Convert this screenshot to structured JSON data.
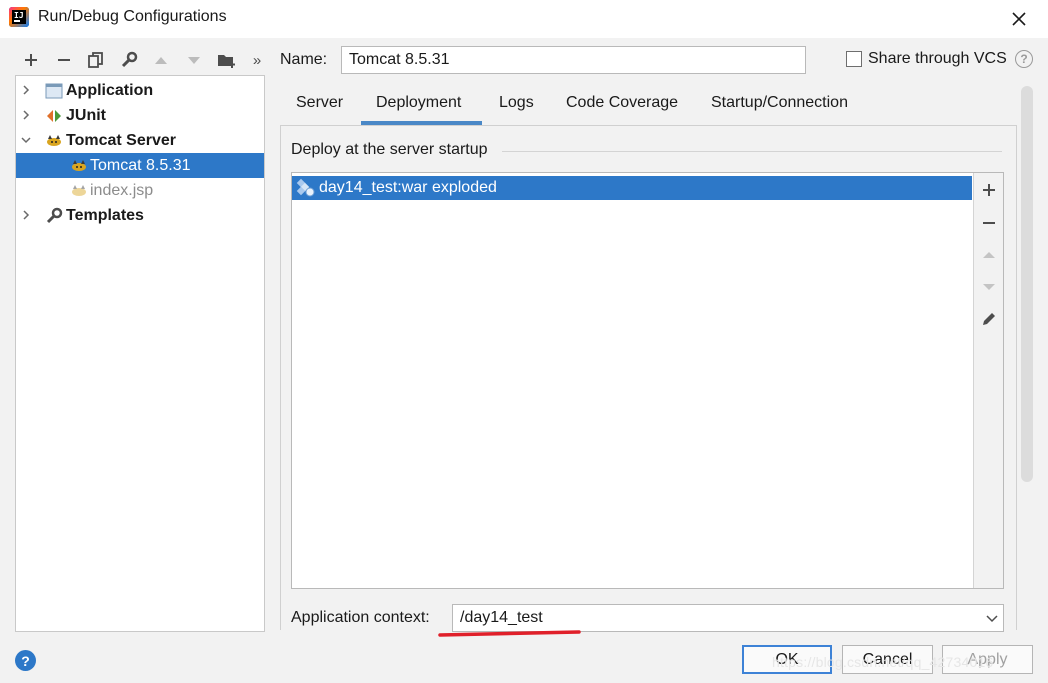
{
  "window": {
    "title": "Run/Debug Configurations"
  },
  "toolbar": {
    "icons": [
      "add-icon",
      "remove-icon",
      "copy-icon",
      "wrench-icon",
      "move-up-icon",
      "move-down-icon",
      "new-folder-icon",
      "more-icon"
    ],
    "more_glyph": "»"
  },
  "tree": {
    "items": [
      {
        "label": "Application",
        "icon": "application-icon",
        "expanded": false
      },
      {
        "label": "JUnit",
        "icon": "junit-icon",
        "expanded": false
      },
      {
        "label": "Tomcat Server",
        "icon": "tomcat-icon",
        "expanded": true
      },
      {
        "label": "Tomcat 8.5.31",
        "icon": "tomcat-icon",
        "selected": true
      },
      {
        "label": "index.jsp",
        "icon": "tomcat-icon",
        "muted": true
      },
      {
        "label": "Templates",
        "icon": "wrench-icon",
        "expanded": false
      }
    ]
  },
  "name_field": {
    "label": "Name:",
    "value": "Tomcat 8.5.31"
  },
  "share": {
    "label": "Share through VCS",
    "checked": false,
    "help": "?"
  },
  "tabs": [
    {
      "label": "Server"
    },
    {
      "label": "Deployment",
      "active": true
    },
    {
      "label": "Logs"
    },
    {
      "label": "Code Coverage"
    },
    {
      "label": "Startup/Connection"
    }
  ],
  "deploy": {
    "section_title": "Deploy at the server startup",
    "artifacts": [
      {
        "label": "day14_test:war exploded",
        "selected": true
      }
    ],
    "side_buttons": [
      "add-icon",
      "remove-icon",
      "move-up-icon",
      "move-down-icon",
      "edit-icon"
    ]
  },
  "app_context": {
    "label": "Application context:",
    "value": "/day14_test"
  },
  "buttons": {
    "ok": "OK",
    "cancel": "Cancel",
    "apply": "Apply",
    "help": "?"
  },
  "watermark": "https://blog.csdn.net/qq_42734016",
  "colors": {
    "selection": "#2d78c8",
    "accent": "#4a88c7",
    "annotation": "#e0202a"
  }
}
